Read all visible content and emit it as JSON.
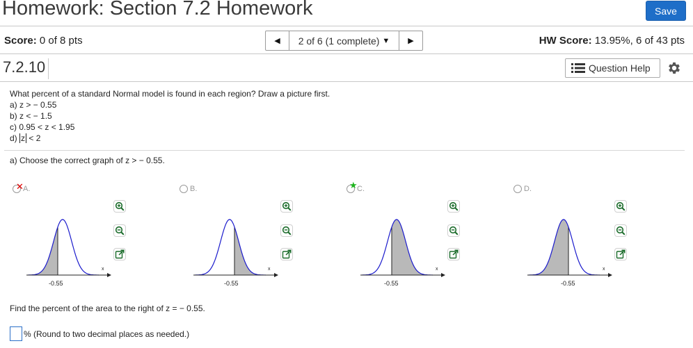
{
  "header": {
    "title": "Homework: Section 7.2 Homework",
    "save_label": "Save"
  },
  "score_bar": {
    "score_label": "Score:",
    "score_value": "0 of 8 pts",
    "nav_text": "2 of 6 (1 complete)",
    "hw_score_label": "HW Score:",
    "hw_score_value": "13.95%, 6 of 43 pts"
  },
  "question_bar": {
    "question_id": "7.2.10",
    "help_label": "Question Help"
  },
  "question": {
    "prompt": "What percent of a standard Normal model is found in each region? Draw a picture first.",
    "parts": {
      "a": "a) z >  − 0.55",
      "b": "b) z <  − 1.5",
      "c": "c) 0.95 < z < 1.95",
      "d_prefix": "d)",
      "d_var": "z",
      "d_suffix": "< 2"
    },
    "sub_question": "a) Choose the correct graph of z >  − 0.55.",
    "options": [
      {
        "letter": "A.",
        "tick": "-0.55",
        "x_label": "x"
      },
      {
        "letter": "B.",
        "tick": "-0.55",
        "x_label": "x"
      },
      {
        "letter": "C.",
        "tick": "-0.55",
        "x_label": "x"
      },
      {
        "letter": "D.",
        "tick": "-0.55",
        "x_label": "x"
      }
    ],
    "find_text": "Find the percent of the area to the right of z =  − 0.55.",
    "answer_suffix": "% (Round to two decimal places as needed.)"
  },
  "colors": {
    "accent": "#1e6ec8",
    "curve": "#1a1acc",
    "shade": "#b9b9b9",
    "wrong_mark": "#e00000",
    "correct_mark": "#1cb51c"
  },
  "icons": {
    "nav_prev": "triangle-left-icon",
    "nav_next": "triangle-right-icon",
    "help": "list-icon",
    "settings": "gear-icon",
    "zoom_in": "zoom-in-icon",
    "zoom_out": "zoom-out-icon",
    "popout": "popout-icon"
  }
}
